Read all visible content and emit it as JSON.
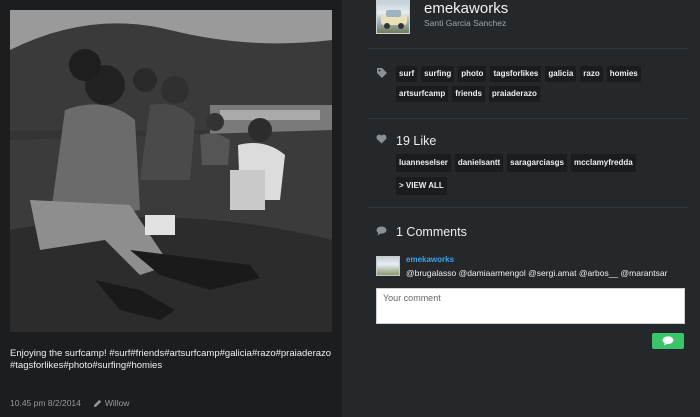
{
  "post": {
    "caption": "Enjoying the surfcamp! #surf#friends#artsurfcamp#galicia#razo#praiaderazo#tagsforlikes#photo#surfing#homies",
    "timestamp": "10.45 pm 8/2/2014",
    "filter": "Willow",
    "photo_icon": "group-photo"
  },
  "user": {
    "username": "emekaworks",
    "real_name": "Santi Garcia Sanchez",
    "avatar_icon": "car-avatar"
  },
  "tags": [
    "surf",
    "surfing",
    "photo",
    "tagsforlikes",
    "galicia",
    "razo",
    "homies",
    "artsurfcamp",
    "friends",
    "praiaderazo"
  ],
  "likes": {
    "title": "19 Like",
    "users": [
      "luanneselser",
      "danielsantt",
      "saragarciasgs",
      "mcclamyfredda"
    ],
    "view_all": "> VIEW ALL"
  },
  "comments": {
    "title": "1 Comments",
    "items": [
      {
        "author": "emekaworks",
        "text": "@brugalasso @damiaarmengol @sergi.amat @arbos__ @marantsar"
      }
    ],
    "input_placeholder": "Your comment",
    "send_icon": "speech-bubble-icon"
  },
  "colors": {
    "accent_link": "#3fa2e8",
    "send_button": "#39c46a",
    "background": "#24282b"
  }
}
